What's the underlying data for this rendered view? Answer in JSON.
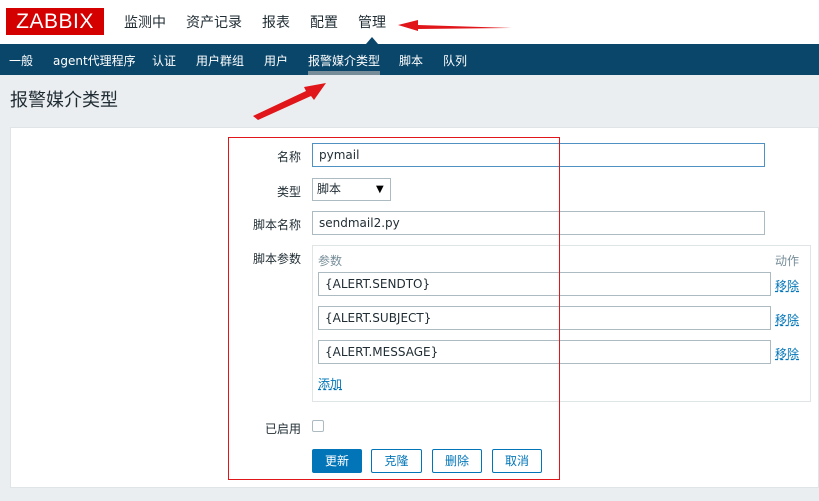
{
  "header": {
    "logo": "ZABBIX",
    "menu": [
      "监测中",
      "资产记录",
      "报表",
      "配置",
      "管理"
    ]
  },
  "subnav": [
    "一般",
    "agent代理程序",
    "认证",
    "用户群组",
    "用户",
    "报警媒介类型",
    "脚本",
    "队列"
  ],
  "page": {
    "title": "报警媒介类型"
  },
  "form": {
    "name_label": "名称",
    "name_value": "pymail",
    "type_label": "类型",
    "type_value": "脚本",
    "script_label": "脚本名称",
    "script_value": "sendmail2.py",
    "params_label": "脚本参数",
    "params_header": "参数",
    "action_header": "动作",
    "params": [
      "{ALERT.SENDTO}",
      "{ALERT.SUBJECT}",
      "{ALERT.MESSAGE}"
    ],
    "remove_label": "移除",
    "add_label": "添加",
    "enabled_label": "已启用",
    "enabled": false
  },
  "buttons": {
    "update": "更新",
    "clone": "克隆",
    "delete": "删除",
    "cancel": "取消"
  },
  "colors": {
    "brand_red": "#d40000",
    "subnav_bg": "#0a466a",
    "primary_blue": "#0275b8",
    "annotation_red": "#e0161a"
  },
  "icons": {
    "select_arrow": "triangle-down-icon",
    "annotation": "red-arrow"
  }
}
